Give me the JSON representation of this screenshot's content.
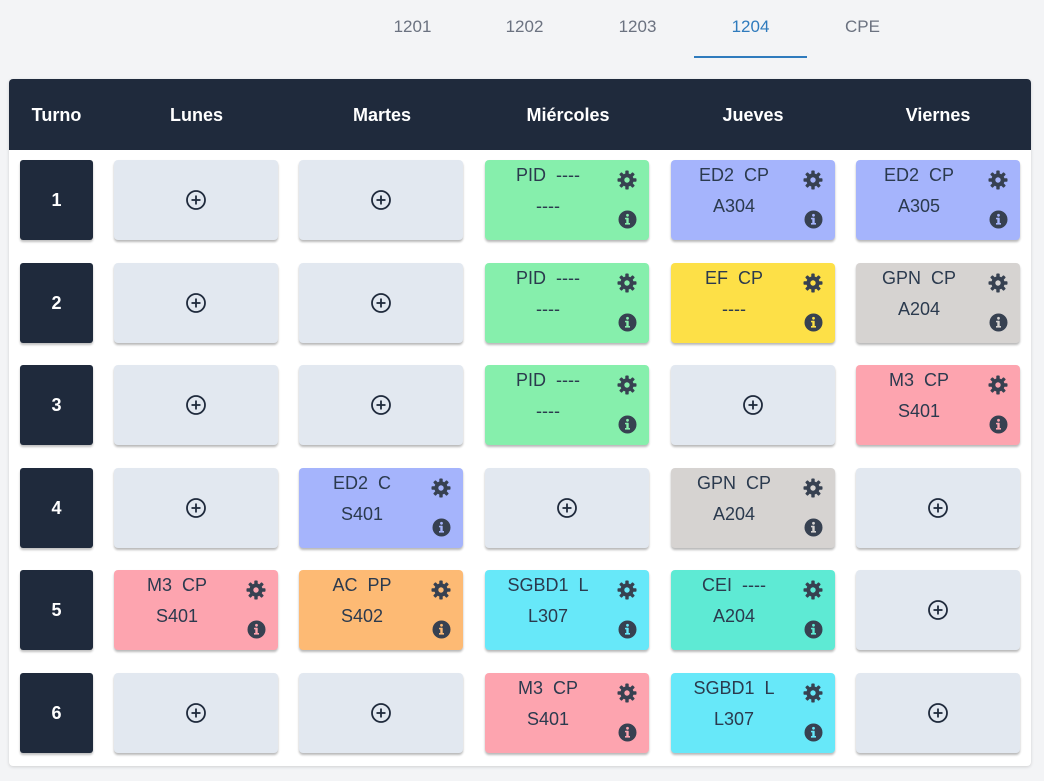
{
  "tabs": [
    {
      "label": "1201",
      "active": false
    },
    {
      "label": "1202",
      "active": false
    },
    {
      "label": "1203",
      "active": false
    },
    {
      "label": "1204",
      "active": true
    },
    {
      "label": "CPE",
      "active": false
    }
  ],
  "header": [
    "Turno",
    "Lunes",
    "Martes",
    "Miércoles",
    "Jueves",
    "Viernes"
  ],
  "colors": {
    "header_bg": "#1f2a3c",
    "empty": "#e2e8f0",
    "green": "#86efac",
    "indigo": "#a5b4fc",
    "yellow": "#fde047",
    "stone": "#d6d3d1",
    "pink": "#fda4af",
    "orange": "#fdba74",
    "cyan": "#67e8f9",
    "teal": "#5eead4",
    "active_tab": "#2f7bbd"
  },
  "icons": {
    "add": "plus-circle-icon",
    "settings": "gear-icon",
    "info": "info-circle-icon"
  },
  "rows": [
    {
      "turno": "1",
      "cells": [
        null,
        null,
        {
          "l1": "PID  ----",
          "l2": "----",
          "color": "green"
        },
        {
          "l1": "ED2  CP",
          "l2": "A304",
          "color": "indigo"
        },
        {
          "l1": "ED2  CP",
          "l2": "A305",
          "color": "indigo"
        }
      ]
    },
    {
      "turno": "2",
      "cells": [
        null,
        null,
        {
          "l1": "PID  ----",
          "l2": "----",
          "color": "green"
        },
        {
          "l1": "EF  CP",
          "l2": "----",
          "color": "yellow"
        },
        {
          "l1": "GPN  CP",
          "l2": "A204",
          "color": "stone"
        }
      ]
    },
    {
      "turno": "3",
      "cells": [
        null,
        null,
        {
          "l1": "PID  ----",
          "l2": "----",
          "color": "green"
        },
        null,
        {
          "l1": "M3  CP",
          "l2": "S401",
          "color": "pink"
        }
      ]
    },
    {
      "turno": "4",
      "cells": [
        null,
        {
          "l1": "ED2  C",
          "l2": "S401",
          "color": "indigo"
        },
        null,
        {
          "l1": "GPN  CP",
          "l2": "A204",
          "color": "stone"
        },
        null
      ]
    },
    {
      "turno": "5",
      "cells": [
        {
          "l1": "M3  CP",
          "l2": "S401",
          "color": "pink"
        },
        {
          "l1": "AC  PP",
          "l2": "S402",
          "color": "orange"
        },
        {
          "l1": "SGBD1  L",
          "l2": "L307",
          "color": "cyan"
        },
        {
          "l1": "CEI  ----",
          "l2": "A204",
          "color": "teal"
        },
        null
      ]
    },
    {
      "turno": "6",
      "cells": [
        null,
        null,
        {
          "l1": "M3  CP",
          "l2": "S401",
          "color": "pink"
        },
        {
          "l1": "SGBD1  L",
          "l2": "L307",
          "color": "cyan"
        },
        null
      ]
    }
  ]
}
